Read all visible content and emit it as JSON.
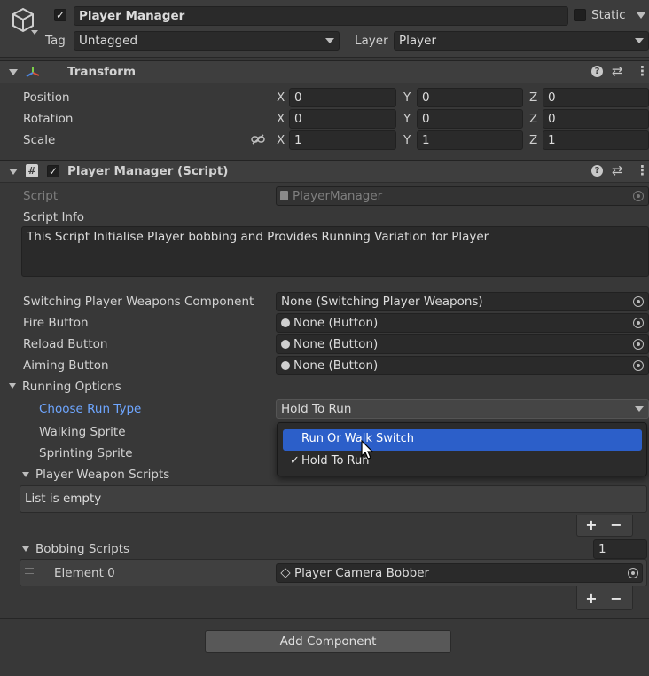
{
  "header": {
    "object_name": "Player Manager",
    "static_label": "Static",
    "tag_label": "Tag",
    "tag_value": "Untagged",
    "layer_label": "Layer",
    "layer_value": "Player"
  },
  "transform": {
    "title": "Transform",
    "position_label": "Position",
    "rotation_label": "Rotation",
    "scale_label": "Scale",
    "position": {
      "x": "0",
      "y": "0",
      "z": "0"
    },
    "rotation": {
      "x": "0",
      "y": "0",
      "z": "0"
    },
    "scale": {
      "x": "1",
      "y": "1",
      "z": "1"
    },
    "axis_x": "X",
    "axis_y": "Y",
    "axis_z": "Z"
  },
  "script_component": {
    "title": "Player Manager (Script)",
    "script_label": "Script",
    "script_value": "PlayerManager",
    "script_info_label": "Script Info",
    "script_info_text": "This Script Initialise Player bobbing and Provides Running Variation for Player",
    "fields": [
      {
        "label": "Switching Player Weapons Component",
        "value": "None (Switching Player Weapons)"
      },
      {
        "label": "Fire Button",
        "value": "None (Button)"
      },
      {
        "label": "Reload Button",
        "value": "None (Button)"
      },
      {
        "label": "Aiming Button",
        "value": "None (Button)"
      }
    ],
    "running_options_label": "Running Options",
    "choose_run_type_label": "Choose Run Type",
    "choose_run_type_value": "Hold To Run",
    "walking_sprite_label": "Walking Sprite",
    "sprinting_sprite_label": "Sprinting Sprite",
    "dropdown_options": [
      {
        "label": "Run Or Walk Switch",
        "highlighted": true,
        "checked": false
      },
      {
        "label": "Hold To Run",
        "highlighted": false,
        "checked": true
      }
    ],
    "check_mark": "✓",
    "weapon_scripts_label": "Player Weapon Scripts",
    "list_empty_text": "List is empty",
    "bobbing_scripts_label": "Bobbing Scripts",
    "bobbing_count": "1",
    "element0_label": "Element 0",
    "element0_value": "Player Camera Bobber",
    "plus": "+",
    "minus": "−"
  },
  "add_component_label": "Add Component",
  "colors": {
    "background": "#383838",
    "field": "#2a2a2a",
    "highlight_blue": "#2c5fc9",
    "accent_label": "#6ea6ff"
  }
}
